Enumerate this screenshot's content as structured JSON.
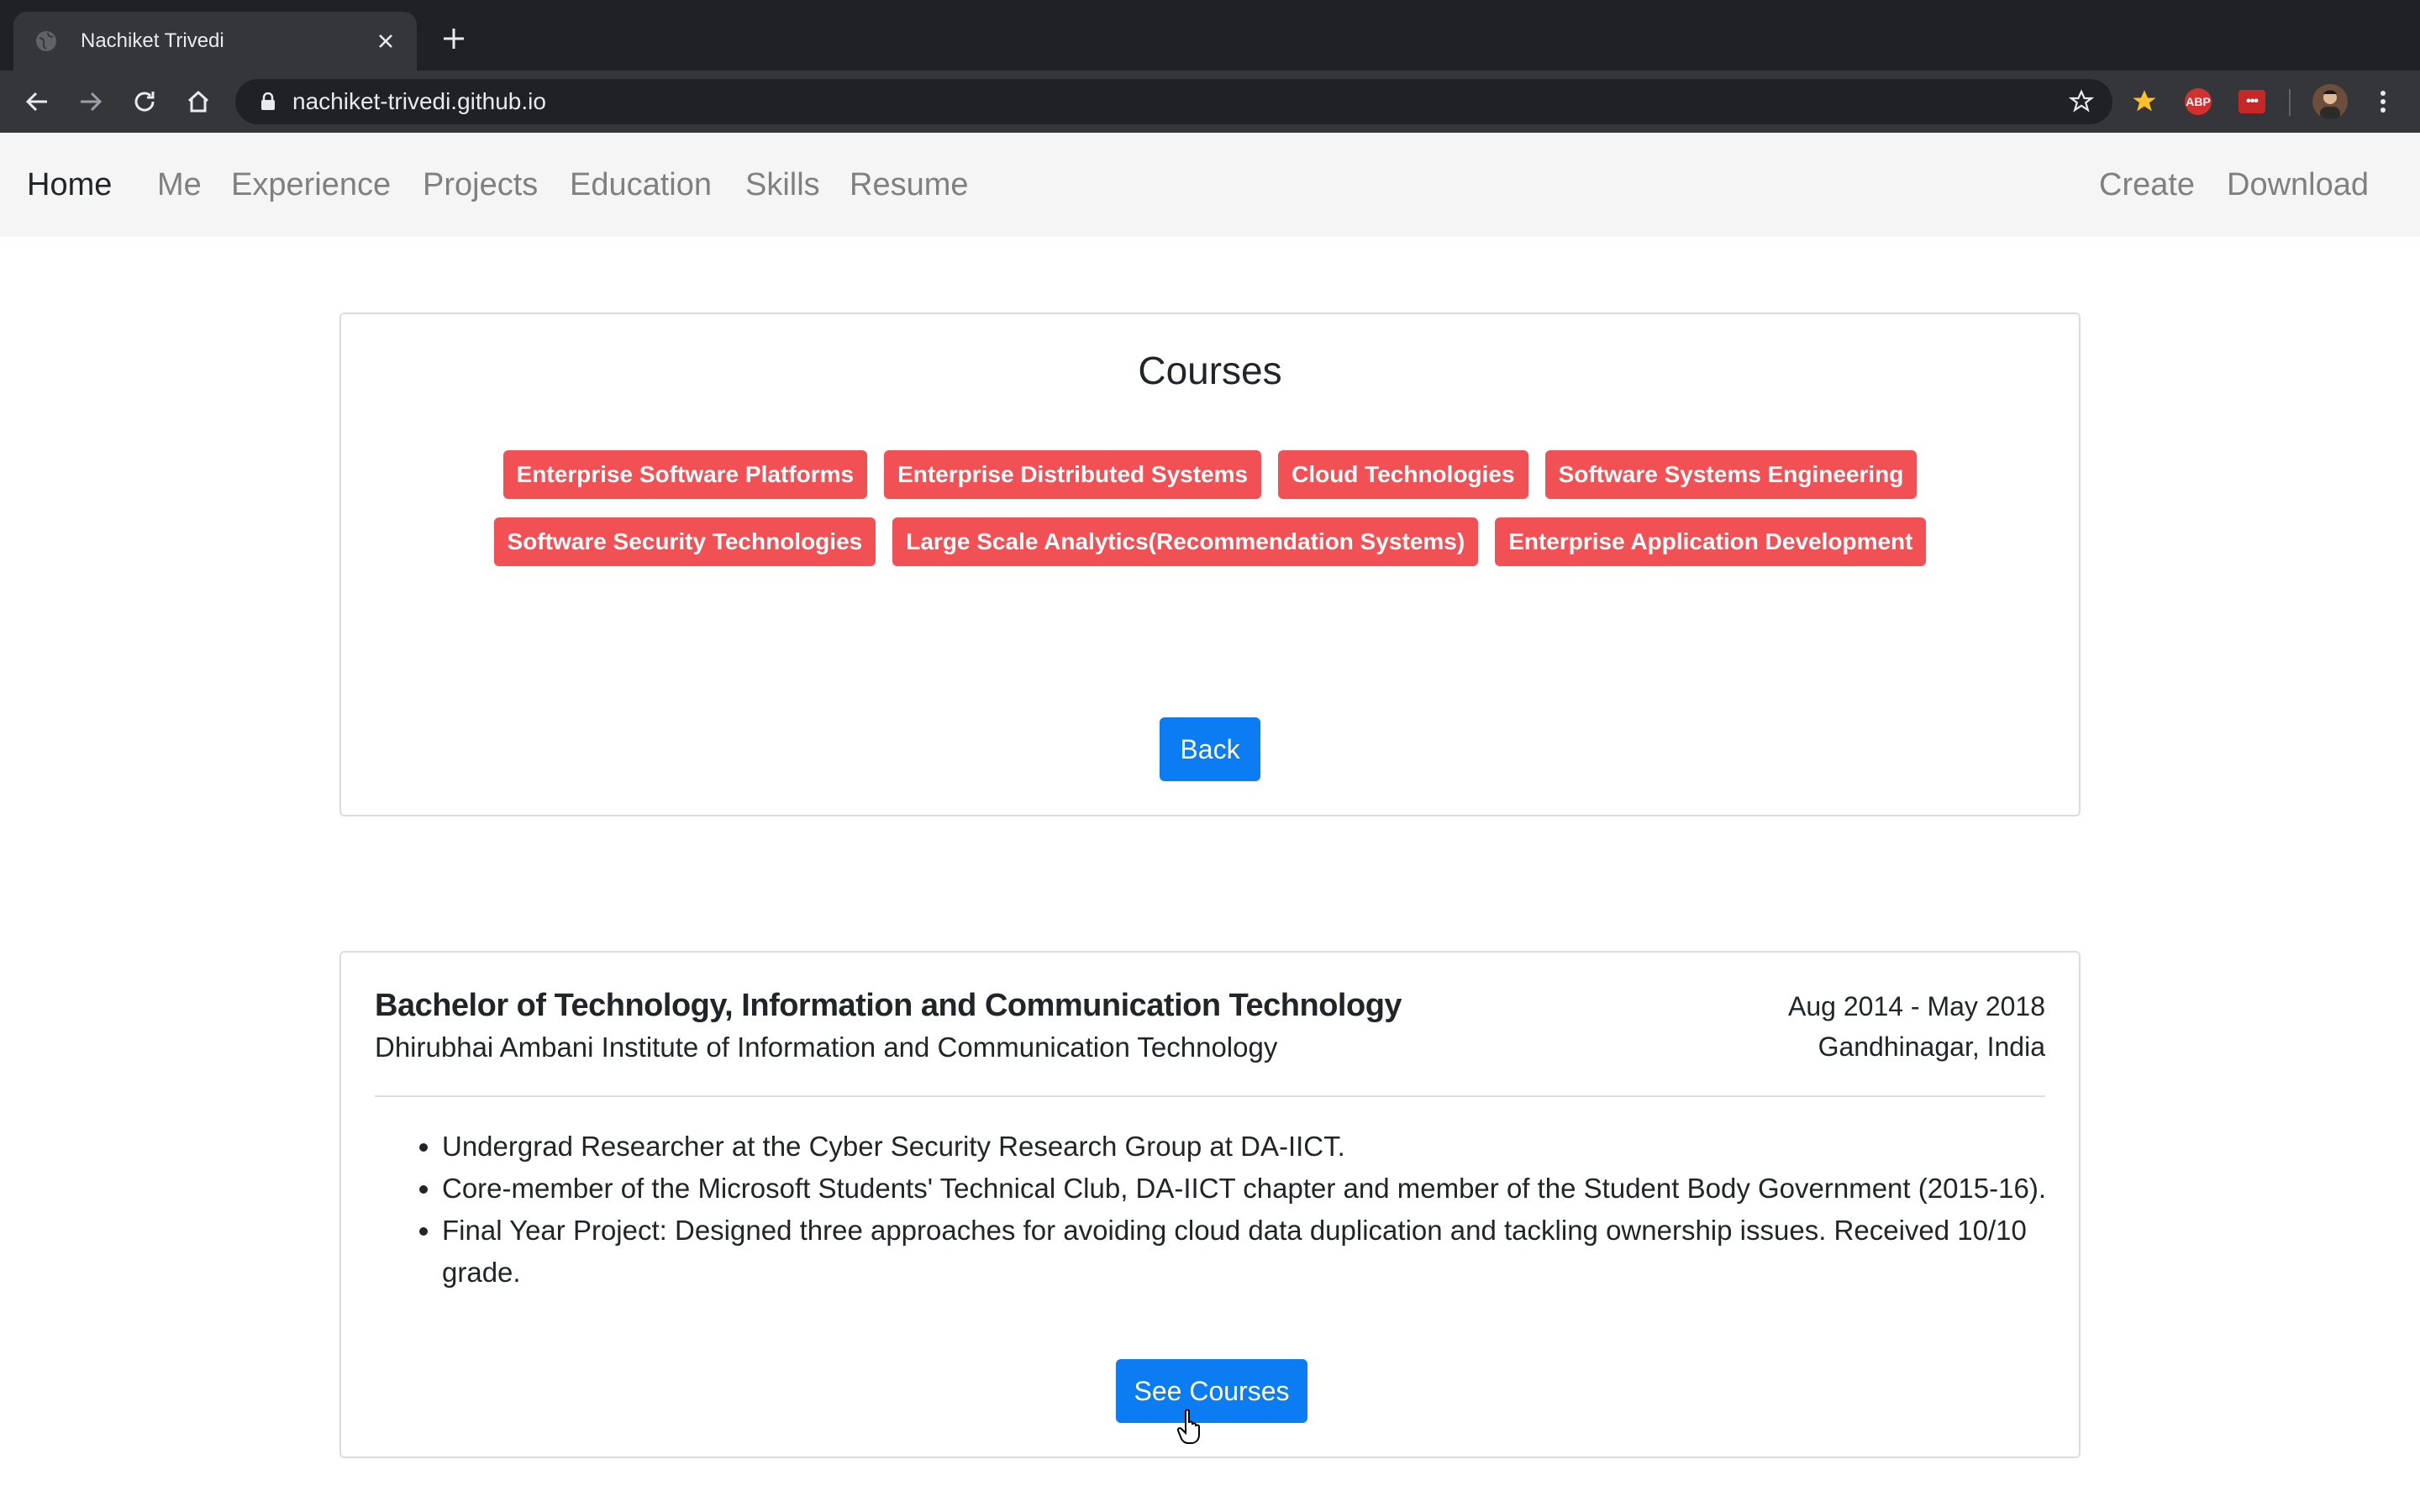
{
  "browser": {
    "tab_title": "Nachiket Trivedi",
    "url": "nachiket-trivedi.github.io",
    "extensions": {
      "abp_label": "ABP",
      "red_ext_label": "•••"
    }
  },
  "nav": {
    "items": [
      "Home",
      "Me",
      "Experience",
      "Projects",
      "Education",
      "Skills",
      "Resume"
    ],
    "right_items": [
      "Create",
      "Download"
    ]
  },
  "courses_card": {
    "title": "Courses",
    "row1": [
      "Enterprise Software Platforms",
      "Enterprise Distributed Systems",
      "Cloud Technologies",
      "Software Systems Engineering"
    ],
    "row2": [
      "Software Security Technologies",
      "Large Scale Analytics(Recommendation Systems)",
      "Enterprise Application Development"
    ],
    "back_label": "Back"
  },
  "degree_card": {
    "title": "Bachelor of Technology, Information and Communication Technology",
    "institution": "Dhirubhai Ambani Institute of Information and Communication Technology",
    "dates": "Aug 2014 - May 2018",
    "location": "Gandhinagar, India",
    "bullets": [
      "Undergrad Researcher at the Cyber Security Research Group at DA-IICT.",
      "Core-member of the Microsoft Students' Technical Club, DA-IICT chapter and member of the Student Body Government (2015-16).",
      "Final Year Project: Designed three approaches for avoiding cloud data duplication and tackling ownership issues. Received 10/10 grade."
    ],
    "see_courses_label": "See Courses"
  },
  "colors": {
    "badge": "#f15054",
    "button": "#0b7cf2",
    "nav_bg": "#f5f5f5",
    "chrome_dark": "#202124",
    "chrome_toolbar": "#35363a"
  }
}
